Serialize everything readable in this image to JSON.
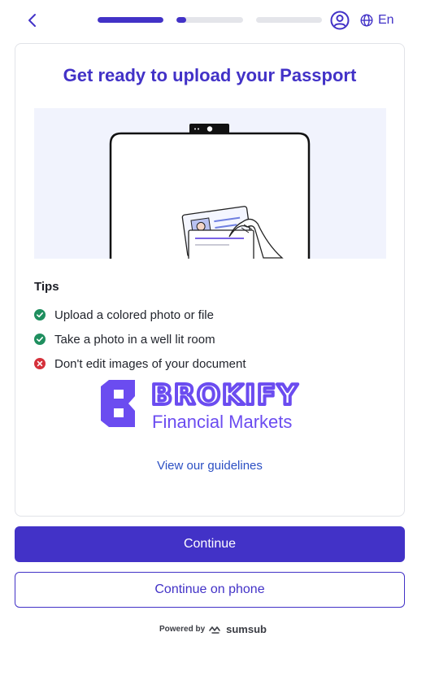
{
  "header": {
    "progress": [
      1.0,
      0.15,
      0.0
    ],
    "language_label": "En",
    "icons": [
      "chevron-left-icon",
      "user-circle-icon",
      "globe-icon"
    ]
  },
  "card": {
    "title": "Get ready to upload your Passport",
    "tips_title": "Tips",
    "tips": [
      {
        "text": "Upload a colored photo or file",
        "status": "ok",
        "icon": "check-circle-icon"
      },
      {
        "text": "Take a photo in a well lit room",
        "status": "ok",
        "icon": "check-circle-icon"
      },
      {
        "text": "Don't edit images of your document",
        "status": "error",
        "icon": "x-circle-icon"
      }
    ],
    "brand": {
      "name": "BROKIFY",
      "tagline": "Financial Markets"
    },
    "guidelines_link": "View our guidelines"
  },
  "actions": {
    "continue_label": "Continue",
    "continue_phone_label": "Continue on phone"
  },
  "footer": {
    "powered_by": "Powered by",
    "provider": "sumsub"
  },
  "colors": {
    "accent": "#4232c7",
    "success": "#1f8f5f",
    "error": "#d5313b",
    "illustration_bg": "#f1f3fd",
    "brand_purple": "#6b4cf0"
  }
}
